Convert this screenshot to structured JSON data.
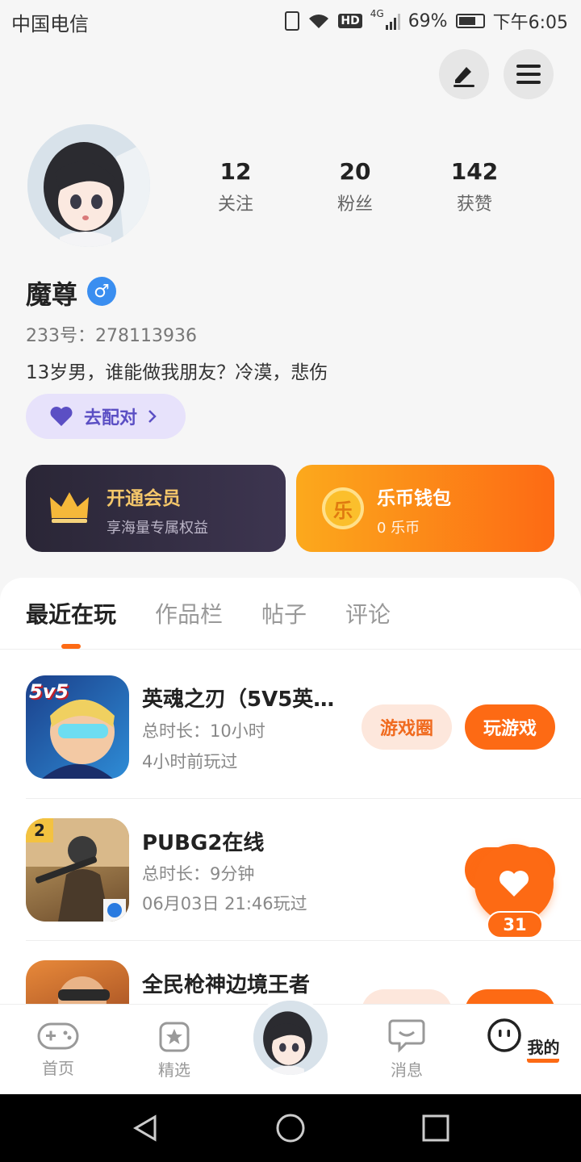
{
  "status_bar": {
    "carrier": "中国电信",
    "battery": "69%",
    "time": "下午6:05",
    "network": "4G"
  },
  "profile": {
    "stats": [
      {
        "num": "12",
        "label": "关注"
      },
      {
        "num": "20",
        "label": "粉丝"
      },
      {
        "num": "142",
        "label": "获赞"
      }
    ],
    "name": "魔尊",
    "gender_symbol": "♂",
    "uid": "233号：278113936",
    "bio": "13岁男，谁能做我朋友？冷漠，悲伤",
    "match_label": "去配对"
  },
  "cards": {
    "vip": {
      "title": "开通会员",
      "sub": "享海量专属权益"
    },
    "coin": {
      "title": "乐币钱包",
      "sub": "0 乐币",
      "coin_char": "乐"
    }
  },
  "tabs": [
    "最近在玩",
    "作品栏",
    "帖子",
    "评论"
  ],
  "games": [
    {
      "title": "英魂之刃（5V5英…",
      "duration": "总时长：10小时",
      "last_played": "4小时前玩过",
      "btn_circle": "游戏圈",
      "btn_play": "玩游戏",
      "badge": "5v5"
    },
    {
      "title": "PUBG2在线",
      "duration": "总时长：9分钟",
      "last_played": "06月03日 21:46玩过",
      "badge": "2"
    },
    {
      "title": "全民枪神边境王者"
    }
  ],
  "like_count": "31",
  "bottom_nav": [
    "首页",
    "精选",
    "消息",
    "我的"
  ],
  "colors": {
    "accent": "#fd6a14",
    "vip_gold": "#f5c76a"
  }
}
